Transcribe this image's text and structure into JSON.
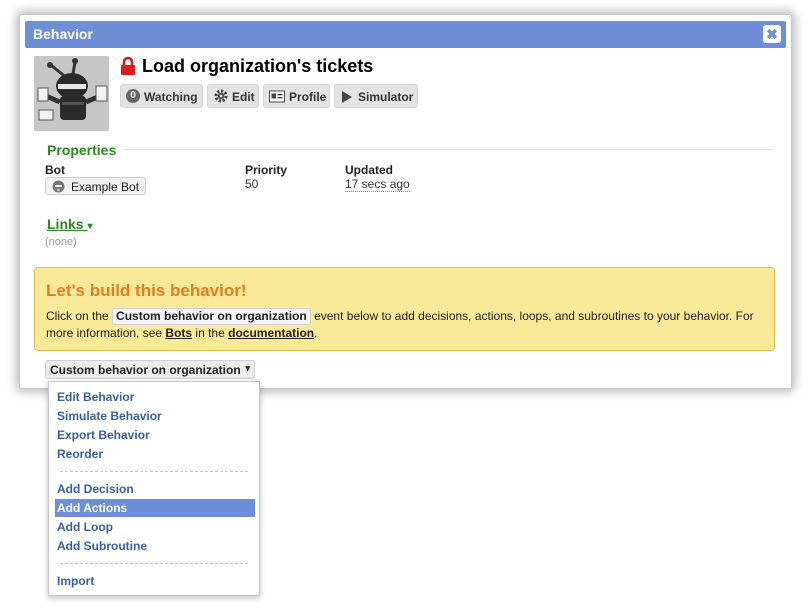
{
  "dialog": {
    "title": "Behavior",
    "close_label": "✖"
  },
  "header": {
    "name": "Load organization's tickets",
    "toolbar": {
      "watching_count": "0",
      "watching_label": "Watching",
      "edit_label": "Edit",
      "profile_label": "Profile",
      "simulator_label": "Simulator"
    }
  },
  "properties": {
    "heading": "Properties",
    "bot_label": "Bot",
    "bot_value": "Example Bot",
    "priority_label": "Priority",
    "priority_value": "50",
    "updated_label": "Updated",
    "updated_value": "17 secs ago"
  },
  "links": {
    "heading": "Links",
    "empty_text": "(none)"
  },
  "callout": {
    "title": "Let's build this behavior!",
    "text_before": "Click on the",
    "event_chip": "Custom behavior on organization",
    "text_after": "event below to add decisions, actions, loops, and subroutines to your behavior. For more information, see",
    "bots_link": "Bots",
    "text_in": "in the",
    "doc_link": "documentation",
    "text_end": "."
  },
  "event_button": {
    "label": "Custom behavior on organization",
    "caret": "▾"
  },
  "menu": {
    "group1": [
      "Edit Behavior",
      "Simulate Behavior",
      "Export Behavior",
      "Reorder"
    ],
    "group2": [
      "Add Decision",
      "Add Actions",
      "Add Loop",
      "Add Subroutine"
    ],
    "group3": [
      "Import"
    ],
    "highlighted": "Add Actions"
  },
  "colors": {
    "titlebar": "#6f8ed8",
    "section_heading": "#2a8a1a",
    "callout_bg": "#fbe99a",
    "callout_title": "#e07f1f",
    "menu_link": "#3a5fa0",
    "lock": "#d62020"
  }
}
